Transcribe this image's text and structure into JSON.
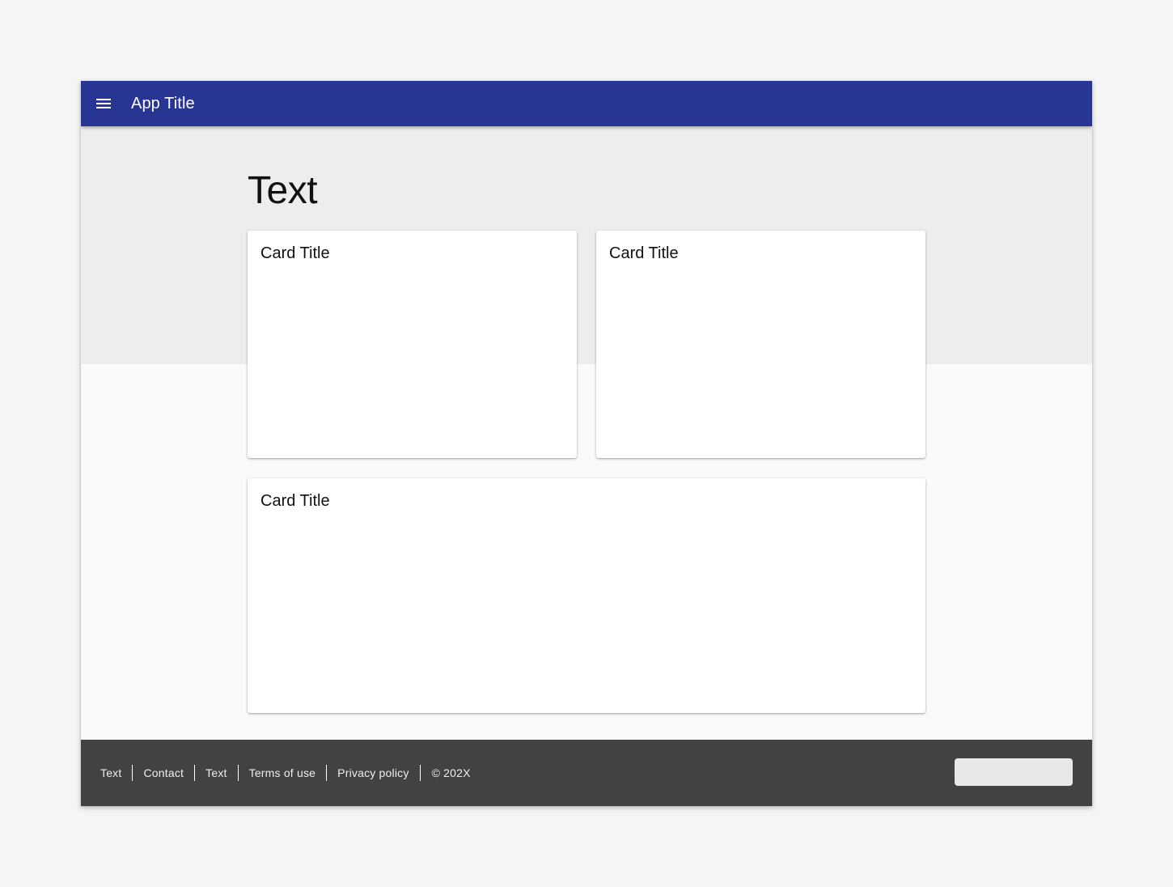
{
  "app_bar": {
    "title": "App Title",
    "menu_icon": "menu-icon",
    "background": "#283593"
  },
  "main": {
    "heading": "Text",
    "cards": [
      {
        "title": "Card Title"
      },
      {
        "title": "Card Title"
      },
      {
        "title": "Card Title"
      }
    ]
  },
  "footer": {
    "links": [
      {
        "label": "Text"
      },
      {
        "label": "Contact"
      },
      {
        "label": "Text"
      },
      {
        "label": "Terms of use"
      },
      {
        "label": "Privacy policy"
      }
    ],
    "copyright": "© 202X",
    "background": "#424242"
  }
}
